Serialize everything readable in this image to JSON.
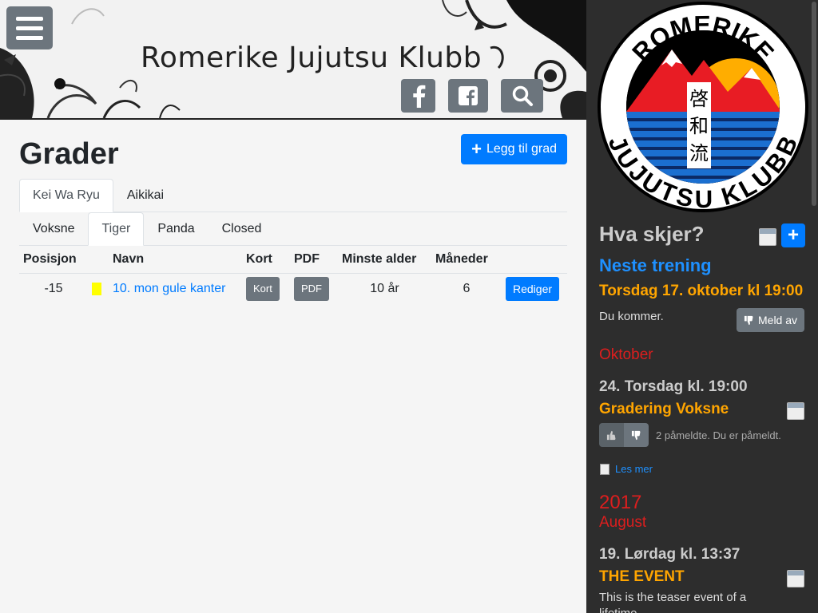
{
  "header": {
    "site_title": "Romerike Jujutsu Klubb",
    "menu_icon": "hamburger-menu-icon",
    "buttons": [
      {
        "icon": "facebook-icon"
      },
      {
        "icon": "facebook-square-icon"
      },
      {
        "icon": "search-icon"
      }
    ]
  },
  "main": {
    "title": "Grader",
    "add_button": "Legg til grad",
    "tabs_primary": [
      "Kei Wa Ryu",
      "Aikikai"
    ],
    "tabs_secondary": [
      "Voksne",
      "Tiger",
      "Panda",
      "Closed"
    ],
    "table": {
      "headers": [
        "Posisjon",
        "",
        "Navn",
        "Kort",
        "PDF",
        "Minste alder",
        "Måneder",
        ""
      ],
      "rows": [
        {
          "position": "-15",
          "belt_color": "#ffff00",
          "name": "10. mon gule kanter",
          "kort": "Kort",
          "pdf": "PDF",
          "min_age": "10 år",
          "months": "6",
          "edit": "Rediger"
        }
      ]
    }
  },
  "sidebar": {
    "logo": {
      "top_text": "ROMERIKE",
      "bottom_text": "JUJUTSU KLUBB",
      "kanji": [
        "啓",
        "和",
        "流"
      ]
    },
    "heading": "Hva skjer?",
    "next_training_label": "Neste trening",
    "next_training_time": "Torsdag 17. oktober kl 19:00",
    "attending_text": "Du kommer.",
    "unregister_button": "Meld av",
    "month1": "Oktober",
    "event1_date": "24. Torsdag kl. 19:00",
    "event1_title": "Gradering Voksne",
    "event1_status": "2 påmeldte. Du er påmeldt.",
    "read_more": "Les mer",
    "year": "2017",
    "month2": "August",
    "event2_date": "19. Lørdag kl. 13:37",
    "event2_title": "THE EVENT",
    "event2_teaser": "This is the teaser event of a lifetime"
  },
  "colors": {
    "primary": "#007bff",
    "secondary": "#6c757d",
    "sidebar_bg": "#2d2d2d",
    "orange": "#ffa500",
    "red": "#dc1e1e"
  }
}
